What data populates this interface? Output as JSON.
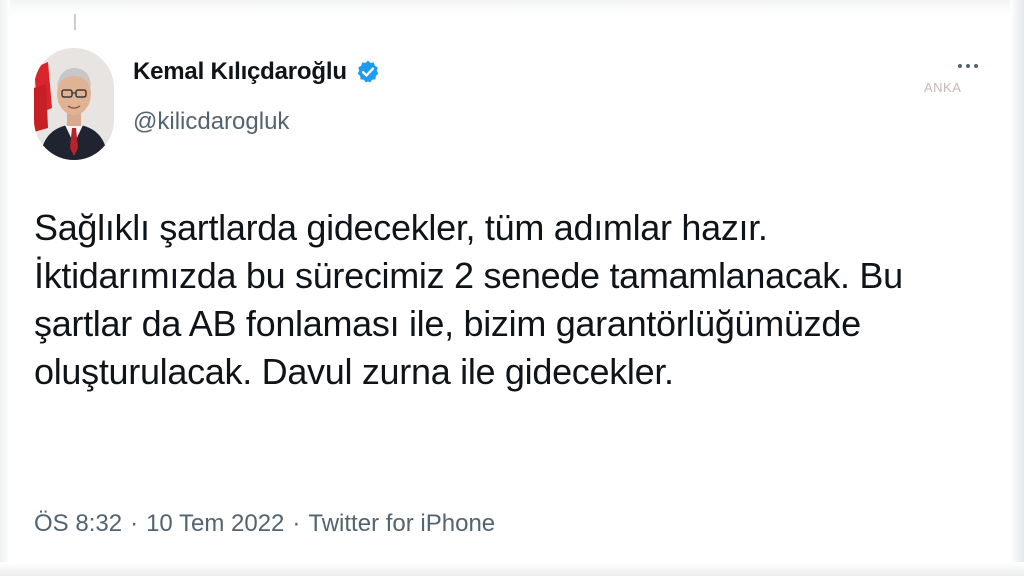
{
  "tweet": {
    "author": {
      "display_name": "Kemal Kılıçdaroğlu",
      "handle": "@kilicdarogluk",
      "verified": true,
      "verified_color": "#1d9bf0"
    },
    "text": "Sağlıklı şartlarda gidecekler, tüm adımlar hazır.\nİktidarımızda bu sürecimiz 2 senede tamamlanacak. Bu şartlar da AB fonlaması ile, bizim garantörlüğümüzde oluşturulacak. Davul zurna ile gidecekler.",
    "time": "ÖS 8:32",
    "date": "10 Tem 2022",
    "source": "Twitter for iPhone",
    "separator": "·",
    "more_icon": "more-horizontal-icon"
  },
  "watermark": "ANKA",
  "colors": {
    "text": "#0f1419",
    "secondary": "#536471",
    "background": "#ffffff"
  }
}
